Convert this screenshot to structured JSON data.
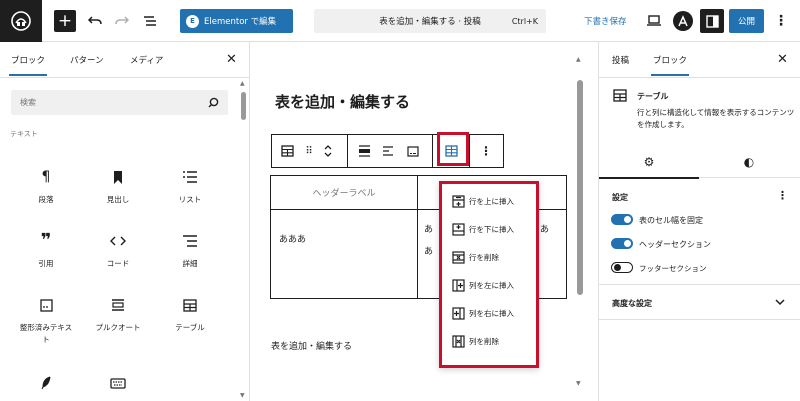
{
  "toolbar": {
    "inserter_icon": "plus-icon",
    "undo_icon": "undo-icon",
    "redo_icon": "redo-icon",
    "list_view_icon": "list-view-icon",
    "elementor_badge": "E",
    "elementor_label": "Elementor で編集",
    "command_text": "表を追加・編集する · 投稿",
    "command_shortcut": "Ctrl+K",
    "save_draft": "下書き保存",
    "publish": "公開"
  },
  "left_panel": {
    "tabs": [
      "ブロック",
      "パターン",
      "メディア"
    ],
    "search_placeholder": "検索",
    "category": "テキスト",
    "blocks": [
      {
        "label": "段落",
        "icon": "paragraph-icon"
      },
      {
        "label": "見出し",
        "icon": "heading-bookmark-icon"
      },
      {
        "label": "リスト",
        "icon": "list-icon"
      },
      {
        "label": "引用",
        "icon": "quote-icon"
      },
      {
        "label": "コード",
        "icon": "code-icon"
      },
      {
        "label": "詳細",
        "icon": "details-icon"
      },
      {
        "label": "整形済みテキスト",
        "icon": "preformatted-icon"
      },
      {
        "label": "プルクオート",
        "icon": "pullquote-icon"
      },
      {
        "label": "テーブル",
        "icon": "table-icon"
      },
      {
        "label": "",
        "icon": "verse-pen-icon"
      },
      {
        "label": "",
        "icon": "keyboard-icon"
      }
    ]
  },
  "editor": {
    "post_title": "表を追加・編集する",
    "table": {
      "header_label": "ヘッダーラベル",
      "cell_1": "あああ",
      "cell_2_line1": "あ",
      "cell_2_line2": "あ",
      "cell_2_overflow": "あ"
    },
    "caption": "表を追加・編集する",
    "table_menu": [
      {
        "label": "行を上に挿入",
        "icon": "row-insert-above-icon"
      },
      {
        "label": "行を下に挿入",
        "icon": "row-insert-below-icon"
      },
      {
        "label": "行を削除",
        "icon": "row-delete-icon"
      },
      {
        "label": "列を左に挿入",
        "icon": "column-insert-left-icon"
      },
      {
        "label": "列を右に挿入",
        "icon": "column-insert-right-icon"
      },
      {
        "label": "列を削除",
        "icon": "column-delete-icon"
      }
    ]
  },
  "right_panel": {
    "tabs": [
      "投稿",
      "ブロック"
    ],
    "block_name": "テーブル",
    "block_description": "行と列に構造化して情報を表示するコンテンツを作成します。",
    "settings_heading": "設定",
    "toggles": [
      {
        "label": "表のセル幅を固定",
        "on": true
      },
      {
        "label": "ヘッダーセクション",
        "on": true
      },
      {
        "label": "フッターセクション",
        "on": false
      }
    ],
    "advanced": "高度な設定"
  },
  "colors": {
    "accent": "#2271b1",
    "highlight_border": "#c8102e",
    "dark": "#1e1e1e"
  }
}
